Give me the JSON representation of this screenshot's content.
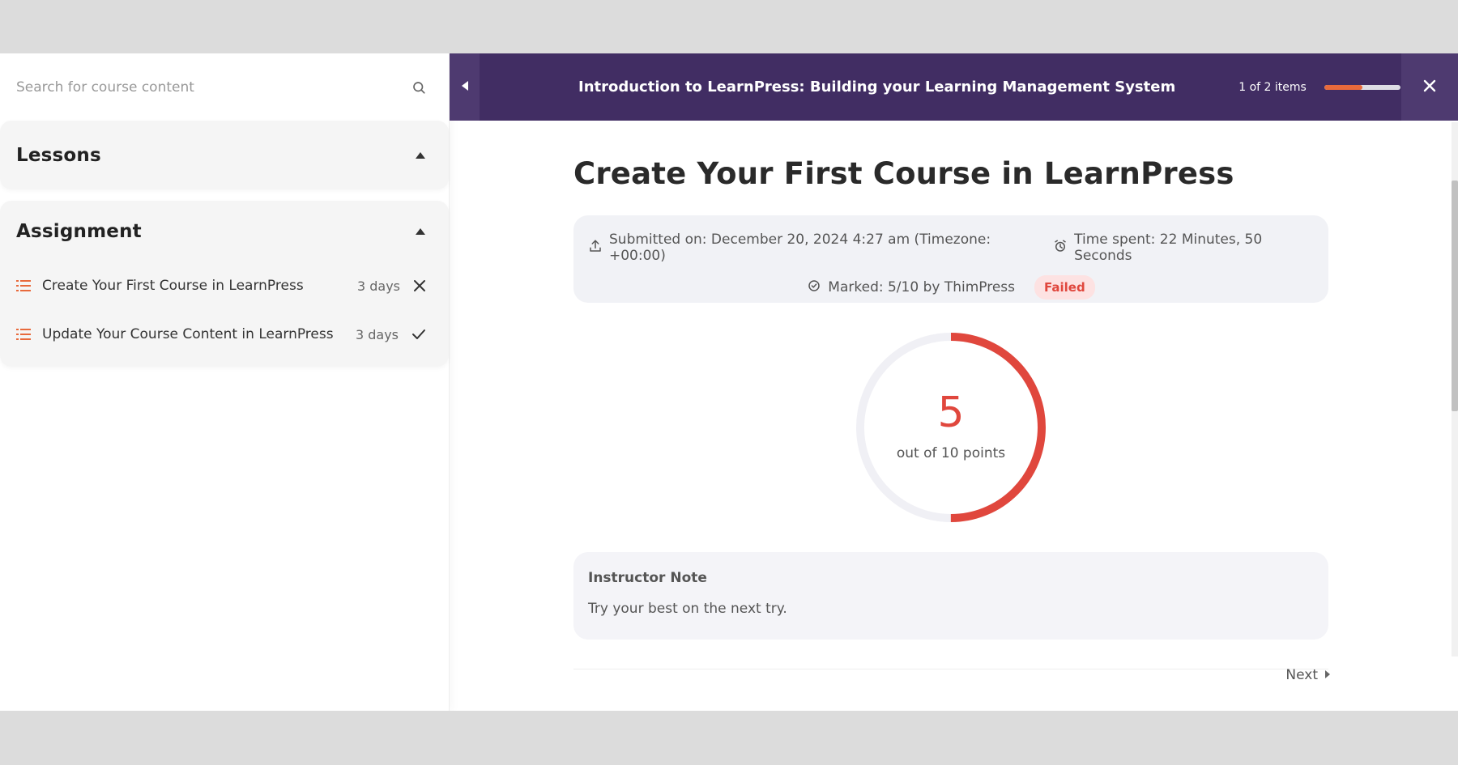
{
  "sidebar": {
    "search": {
      "placeholder": "Search for course content",
      "icon": "search-icon"
    },
    "sections": [
      {
        "title": "Lessons",
        "collapsed": false,
        "items": []
      },
      {
        "title": "Assignment",
        "items": [
          {
            "label": "Create Your First Course in LearnPress",
            "duration": "3 days",
            "status": "failed",
            "status_icon": "close-icon"
          },
          {
            "label": "Update Your Course Content in LearnPress",
            "duration": "3 days",
            "status": "passed",
            "status_icon": "check-icon"
          }
        ]
      }
    ]
  },
  "topbar": {
    "course_title": "Introduction to LearnPress: Building your Learning Management System",
    "items_count": "1 of 2 items",
    "progress_fraction": 0.5,
    "progress_color": "#e86a3c",
    "bg_color": "#412d63"
  },
  "main": {
    "title": "Create Your First Course in LearnPress",
    "submitted": "Submitted on: December 20, 2024 4:27 am (Timezone: +00:00)",
    "time_spent": "Time spent: 22 Minutes, 50 Seconds",
    "marked": "Marked: 5/10 by ThimPress",
    "status_badge": "Failed",
    "score": {
      "value": "5",
      "subtitle": "out of 10 points",
      "fraction": 0.5,
      "color": "#e0473d"
    },
    "note": {
      "title": "Instructor Note",
      "text": "Try your best on the next try."
    },
    "next_label": "Next"
  }
}
